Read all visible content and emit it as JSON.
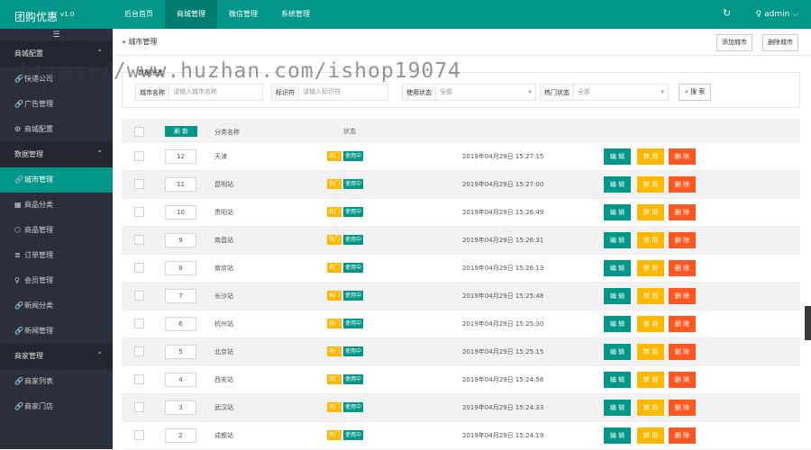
{
  "app": {
    "logo": "团购优惠",
    "version": "v1.0"
  },
  "topnav": [
    "后台首页",
    "商城管理",
    "微信管理",
    "系统管理"
  ],
  "user": "admin",
  "sidebar": {
    "groups": [
      {
        "label": "商城配置",
        "items": [
          "快递公司",
          "广告管理",
          "商城配置"
        ]
      },
      {
        "label": "数据管理",
        "items": [
          "城市管理",
          "商品分类",
          "商品管理",
          "订单管理",
          "会员管理",
          "新闻分类",
          "新闻管理"
        ]
      },
      {
        "label": "商家管理",
        "items": [
          "商家列表",
          "商家门店"
        ]
      }
    ]
  },
  "breadcrumb": "城市管理",
  "header_buttons": {
    "add": "添加城市",
    "delete": "删除城市"
  },
  "watermark": "https://www.huzhan.com/ishop19074",
  "search": {
    "legend": "数据筛选",
    "city_label": "城市名称",
    "city_placeholder": "请输入城市名称",
    "ident_label": "标识符",
    "ident_placeholder": "请输入标识符",
    "use_label": "使用状态",
    "use_value": "全部",
    "hot_label": "热门状态",
    "hot_value": "全部",
    "button": "搜 索"
  },
  "table": {
    "refresh": "刷 新",
    "col_name": "分类名称",
    "col_status": "状态",
    "tag_hot": "热门",
    "tag_use": "使用中",
    "btn_edit": "编 辑",
    "btn_disable": "禁 用",
    "btn_delete": "删 除",
    "rows": [
      {
        "order": "12",
        "name": "天津",
        "time": "2019年04月29日 15:27:15"
      },
      {
        "order": "11",
        "name": "昆明站",
        "time": "2019年04月29日 15:27:00"
      },
      {
        "order": "10",
        "name": "贵阳站",
        "time": "2019年04月29日 15:26:49"
      },
      {
        "order": "9",
        "name": "南昌站",
        "time": "2019年04月29日 15:26:31"
      },
      {
        "order": "8",
        "name": "南京站",
        "time": "2019年04月29日 15:26:13"
      },
      {
        "order": "7",
        "name": "长沙站",
        "time": "2019年04月29日 15:25:48"
      },
      {
        "order": "6",
        "name": "杭州站",
        "time": "2019年04月29日 15:25:30"
      },
      {
        "order": "5",
        "name": "北京站",
        "time": "2019年04月29日 15:25:15"
      },
      {
        "order": "4",
        "name": "西安站",
        "time": "2019年04月29日 15:24:56"
      },
      {
        "order": "3",
        "name": "武汉站",
        "time": "2019年04月29日 15:24:33"
      },
      {
        "order": "2",
        "name": "成都站",
        "time": "2019年04月29日 15:24:19"
      }
    ]
  }
}
